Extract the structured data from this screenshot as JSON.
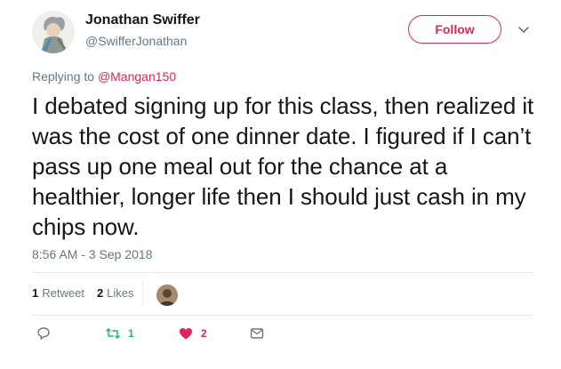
{
  "user": {
    "display_name": "Jonathan Swiffer",
    "handle": "@SwifferJonathan"
  },
  "follow_button": {
    "label": "Follow"
  },
  "reply_context": {
    "prefix": "Replying to ",
    "mention": "@Mangan150"
  },
  "tweet": {
    "text": "I debated signing up for this class, then realized it was the cost of one dinner date. I figured if I can’t pass up one meal out for the chance at a healthier, longer life then I should just cash in my chips now.",
    "timestamp": "8:56 AM - 3 Sep 2018"
  },
  "stats": {
    "retweets_count": "1",
    "retweets_label": "Retweet",
    "likes_count": "2",
    "likes_label": "Likes"
  },
  "actions": {
    "reply_count": "",
    "retweet_count": "1",
    "like_count": "2",
    "dm_count": ""
  },
  "icons": {
    "reply": "reply-icon",
    "retweet": "retweet-icon",
    "like": "heart-icon",
    "dm": "envelope-icon",
    "caret": "chevron-down-icon"
  },
  "colors": {
    "accent": "#e0245e",
    "retweet": "#17bf63",
    "muted": "#657786",
    "text": "#14171a"
  }
}
